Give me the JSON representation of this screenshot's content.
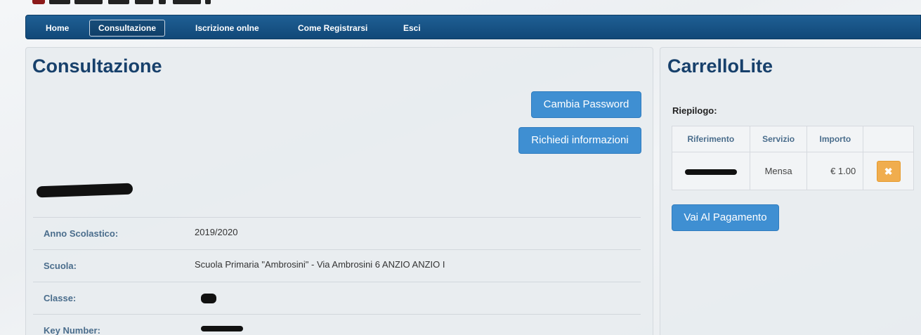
{
  "nav": {
    "items": [
      {
        "label": "Home"
      },
      {
        "label": "Consultazione"
      },
      {
        "label": "Iscrizione onlne"
      },
      {
        "label": "Come Registrarsi"
      },
      {
        "label": "Esci"
      }
    ],
    "active": "Consultazione"
  },
  "left_panel": {
    "title": "Consultazione",
    "buttons": {
      "change_password": "Cambia Password",
      "request_info": "Richiedi informazioni"
    },
    "info": [
      {
        "label": "Anno Scolastico:",
        "value": "2019/2020"
      },
      {
        "label": "Scuola:",
        "value": "Scuola Primaria \"Ambrosini\" - Via Ambrosini 6 ANZIO ANZIO I"
      },
      {
        "label": "Classe:",
        "value": ""
      },
      {
        "label": "Key Number:",
        "value": ""
      }
    ]
  },
  "right_panel": {
    "title": "CarrelloLite",
    "summary_label": "Riepilogo:",
    "table": {
      "headers": [
        "Riferimento",
        "Servizio",
        "Importo",
        ""
      ],
      "rows": [
        {
          "riferimento": "",
          "servizio": "Mensa",
          "importo": "€ 1.00"
        }
      ]
    },
    "pay_button": "Vai Al Pagamento"
  },
  "colors": {
    "navbar": "#114878",
    "title": "#17406b",
    "button": "#3f8fd2",
    "delete": "#f0ad4e"
  },
  "icons": {
    "delete": "close-icon"
  }
}
